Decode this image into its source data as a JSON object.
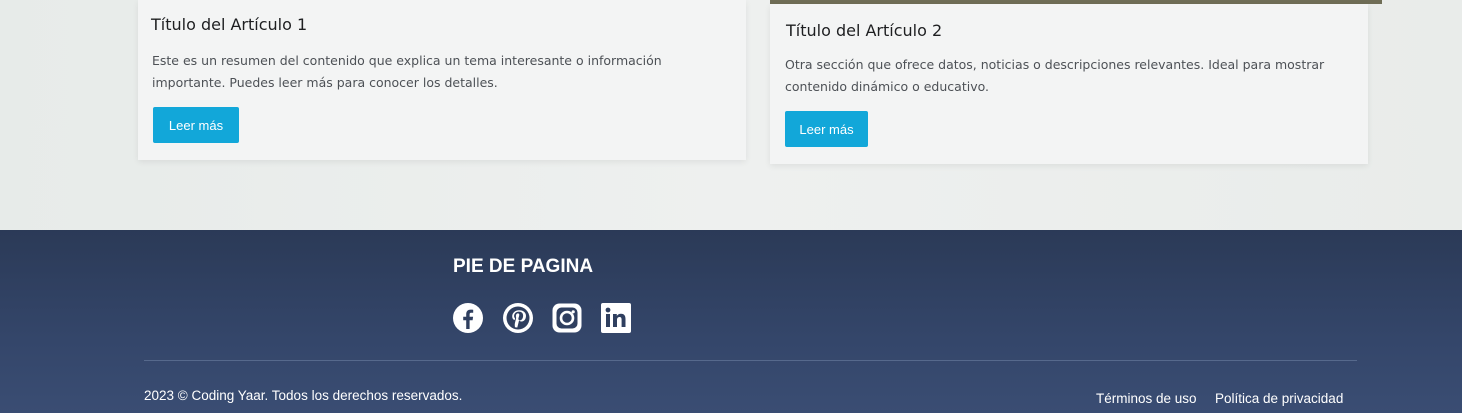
{
  "articles": [
    {
      "title": "Título del Artículo 1",
      "summary": "Este es un resumen del contenido que explica un tema interesante o información importante. Puedes leer más para conocer los detalles.",
      "button_label": "Leer más"
    },
    {
      "title": "Título del Artículo 2",
      "summary": "Otra sección que ofrece datos, noticias o descripciones relevantes. Ideal para mostrar contenido dinámico o educativo.",
      "button_label": "Leer más"
    }
  ],
  "footer": {
    "title": "PIE DE PAGINA",
    "social": [
      {
        "icon": "facebook-icon"
      },
      {
        "icon": "pinterest-icon"
      },
      {
        "icon": "instagram-icon"
      },
      {
        "icon": "linkedin-icon"
      }
    ],
    "copyright": "2023 © Coding Yaar. Todos los derechos reservados.",
    "links": {
      "terms": "Términos de uso",
      "privacy": "Política de privacidad"
    }
  },
  "colors": {
    "button": "#12a7d9",
    "footer_bg": "#2b3a57",
    "page_bg": "#e9ecea"
  }
}
